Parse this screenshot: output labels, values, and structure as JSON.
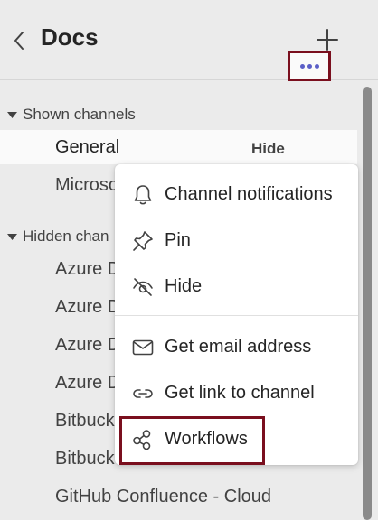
{
  "header": {
    "title": "Docs"
  },
  "sections": {
    "shown": "Shown channels",
    "hidden": "Hidden chan"
  },
  "channels": {
    "shown": [
      "General",
      "Microso"
    ],
    "hidden": [
      "Azure D",
      "Azure D",
      "Azure D",
      "Azure D",
      "Bitbuck",
      "Bitbuck",
      "GitHub Confluence - Cloud"
    ]
  },
  "general_row": {
    "hide_label": "Hide"
  },
  "menu": {
    "items": [
      {
        "label": "Channel notifications",
        "icon": "bell-icon"
      },
      {
        "label": "Pin",
        "icon": "pin-icon"
      },
      {
        "label": "Hide",
        "icon": "eye-off-icon"
      },
      {
        "label": "Get email address",
        "icon": "mail-icon"
      },
      {
        "label": "Get link to channel",
        "icon": "link-icon"
      },
      {
        "label": "Workflows",
        "icon": "workflows-icon"
      }
    ]
  },
  "colors": {
    "accent": "#5b5fc7",
    "highlight": "#7a0f1e",
    "background": "#ebebeb"
  }
}
